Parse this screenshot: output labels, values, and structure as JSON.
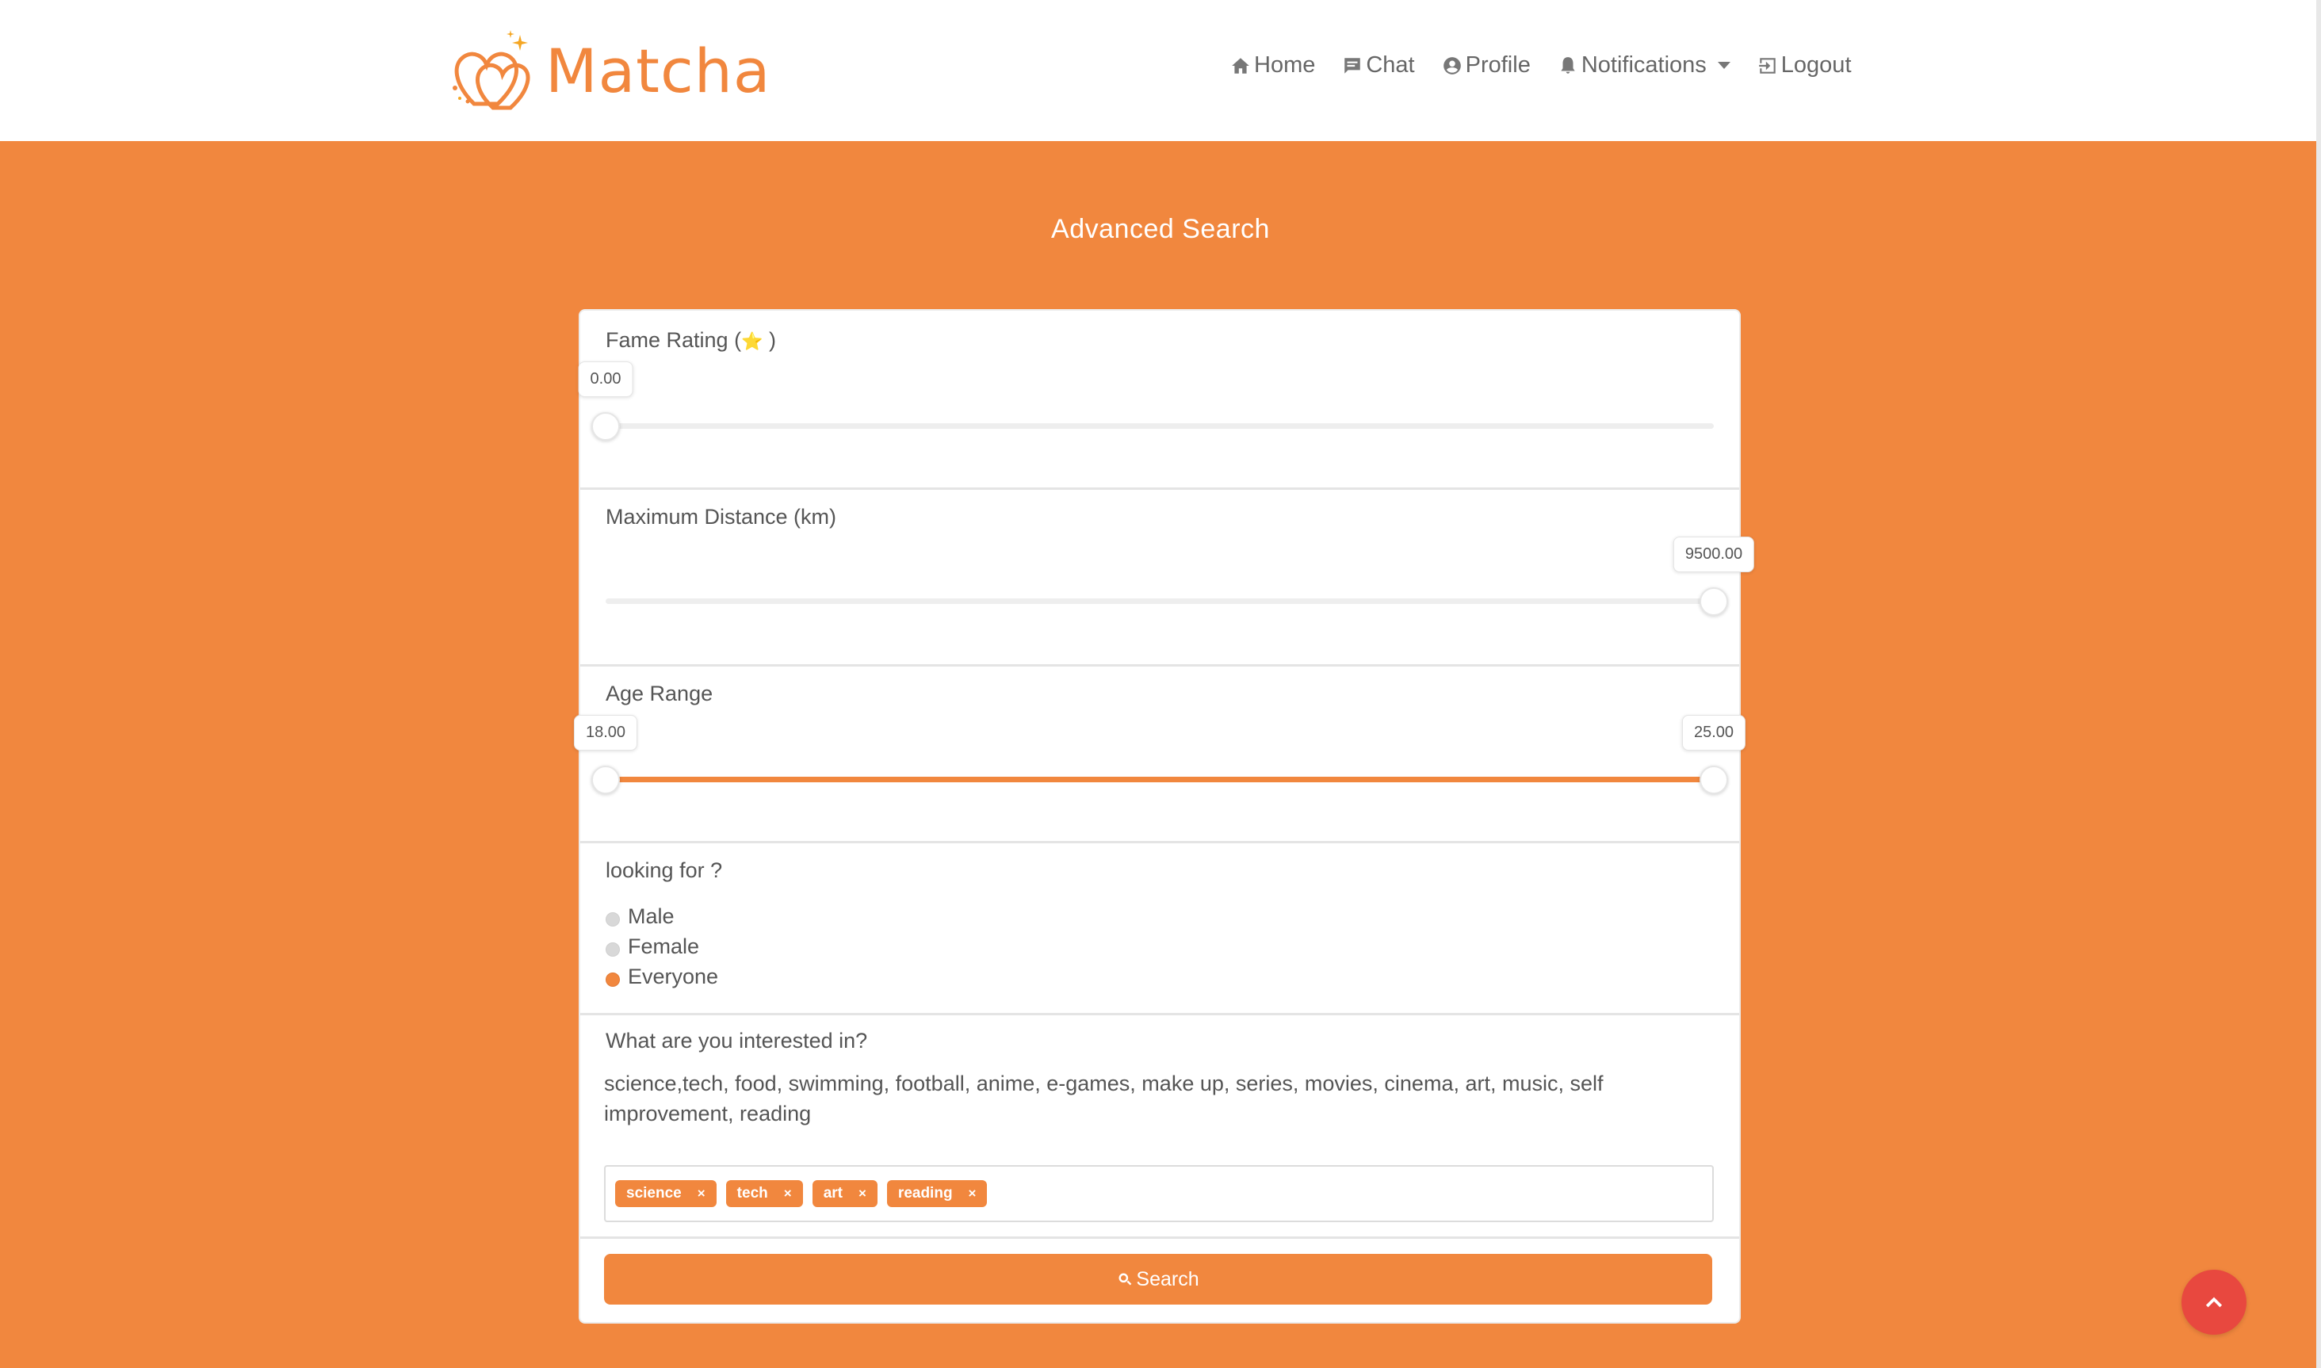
{
  "brand": {
    "name": "Matcha",
    "logo_icon": "double-heart-logo"
  },
  "nav": {
    "home": "Home",
    "chat": "Chat",
    "profile": "Profile",
    "notifications": "Notifications",
    "logout": "Logout"
  },
  "page": {
    "title": "Advanced Search"
  },
  "fame": {
    "label_prefix": "Fame Rating (",
    "label_icon": "⭐",
    "label_suffix": " )",
    "value": "0.00",
    "min": 0,
    "max": 5
  },
  "distance": {
    "label": "Maximum Distance (km)",
    "value": "9500.00",
    "max": 9500
  },
  "age": {
    "label": "Age Range",
    "min_value": "18.00",
    "max_value": "25.00",
    "min": 18,
    "max": 25
  },
  "gender": {
    "label": "looking for ?",
    "options": [
      "Male",
      "Female",
      "Everyone"
    ],
    "selected": "Everyone"
  },
  "interests": {
    "label": "What are you interested in?",
    "available": "science,tech, food, swimming, football, anime, e-games, make up, series, movies, cinema, art, music, self improvement, reading",
    "selected_tags": [
      "science",
      "tech",
      "art",
      "reading"
    ],
    "tag_close": "×"
  },
  "search_button": "Search",
  "colors": {
    "accent": "#f1873e",
    "scroll_top": "#e8483f",
    "background": "#f1873e"
  }
}
